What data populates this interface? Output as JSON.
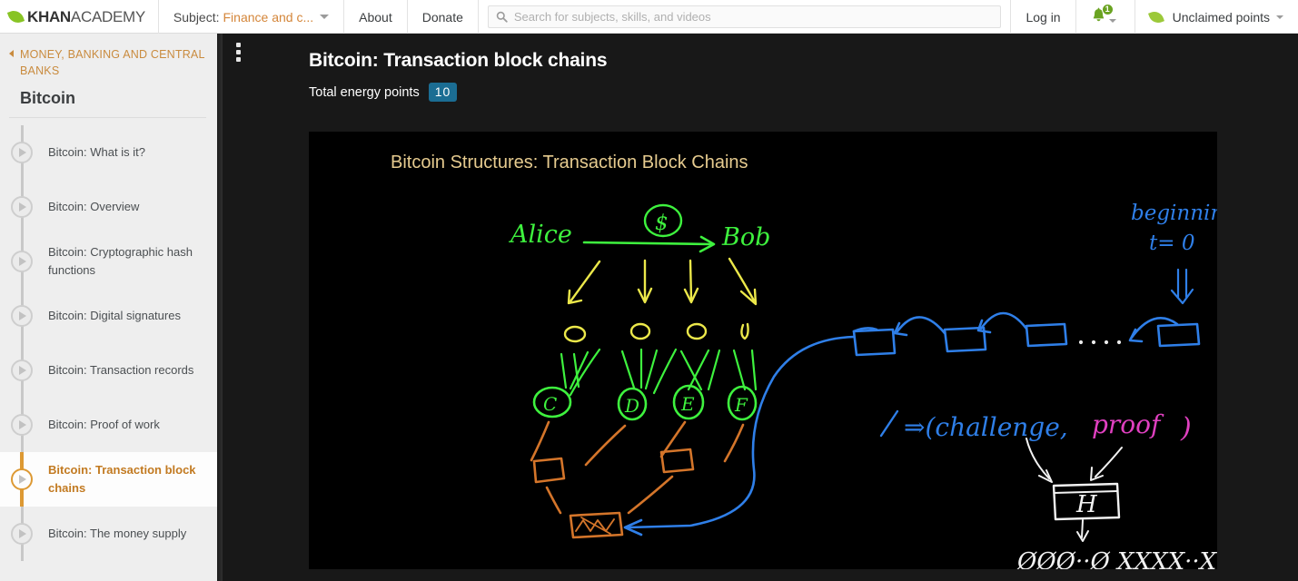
{
  "topnav": {
    "logo": {
      "primary": "KHAN",
      "secondary": "ACADEMY",
      "icon": "leaf-icon"
    },
    "subject": {
      "label": "Subject:",
      "value": "Finance and c...",
      "icon": "chevron-down-icon"
    },
    "about_label": "About",
    "donate_label": "Donate",
    "search": {
      "placeholder": "Search for subjects, skills, and videos",
      "value": "",
      "icon": "search-icon"
    },
    "login_label": "Log in",
    "notifications": {
      "icon": "bell-icon",
      "badge": "1"
    },
    "points": {
      "label": "Unclaimed points",
      "icon": "leaf-icon"
    }
  },
  "sidebar": {
    "breadcrumb": "MONEY, BANKING AND CENTRAL BANKS",
    "title": "Bitcoin",
    "items": [
      {
        "label": "Bitcoin: What is it?",
        "active": false
      },
      {
        "label": "Bitcoin: Overview",
        "active": false
      },
      {
        "label": "Bitcoin: Cryptographic hash functions",
        "active": false
      },
      {
        "label": "Bitcoin: Digital signatures",
        "active": false
      },
      {
        "label": "Bitcoin: Transaction records",
        "active": false
      },
      {
        "label": "Bitcoin: Proof of work",
        "active": false
      },
      {
        "label": "Bitcoin: Transaction block chains",
        "active": true
      },
      {
        "label": "Bitcoin: The money supply",
        "active": false
      }
    ]
  },
  "main": {
    "menu_icon": "kebab-menu-icon",
    "title": "Bitcoin: Transaction block chains",
    "energy_label": "Total energy points",
    "energy_points": "10"
  },
  "whiteboard": {
    "title": "Bitcoin Structures: Transaction Block Chains",
    "labels": {
      "alice": "Alice",
      "bob": "Bob",
      "dollar": "$",
      "beginning": "beginning",
      "time_zero": "t= 0",
      "challenge_proof": "⇒(challenge,  proof)",
      "hash_box": "H",
      "hash_output": "ØØØ··Ø XXXX··X",
      "tree_nodes": [
        "C",
        "D",
        "E",
        "F"
      ]
    },
    "colors": {
      "green": "#3ef23e",
      "yellow": "#ece84a",
      "blue": "#2f7fe8",
      "orange": "#d4752a",
      "white": "#f2f2f2",
      "magenta": "#e040c0",
      "title": "#e6cb8f",
      "background": "#000000"
    }
  },
  "theme": {
    "accent_orange": "#c27a21",
    "badge_blue": "#1b6d93",
    "leaf_green": "#88c425",
    "sidebar_bg": "#eeeeee",
    "main_bg": "#181818"
  }
}
